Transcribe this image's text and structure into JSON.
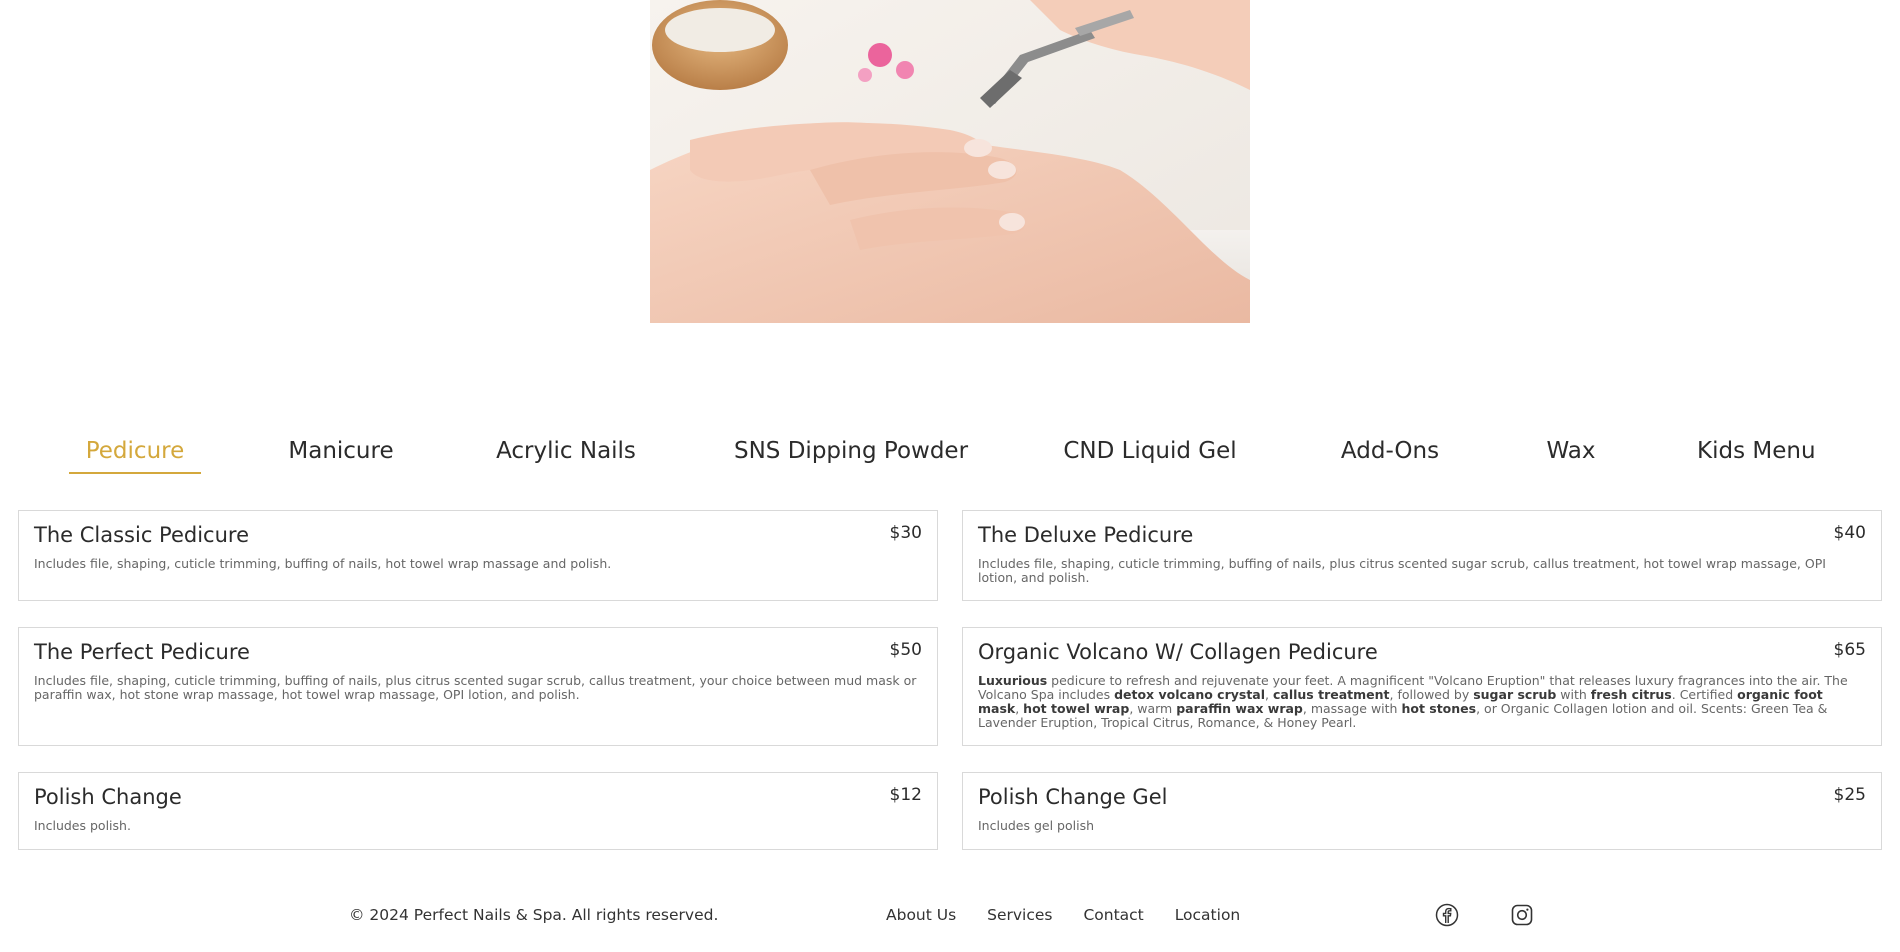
{
  "tabs": [
    {
      "label": "Pedicure",
      "active": true
    },
    {
      "label": "Manicure",
      "active": false
    },
    {
      "label": "Acrylic Nails",
      "active": false
    },
    {
      "label": "SNS Dipping Powder",
      "active": false
    },
    {
      "label": "CND Liquid Gel",
      "active": false
    },
    {
      "label": "Add-Ons",
      "active": false
    },
    {
      "label": "Wax",
      "active": false
    },
    {
      "label": "Kids Menu",
      "active": false
    }
  ],
  "services": [
    {
      "title": "The Classic Pedicure",
      "price": "$30",
      "desc": "Includes file, shaping, cuticle trimming, buffing of nails, hot towel wrap massage and polish."
    },
    {
      "title": "The Deluxe Pedicure",
      "price": "$40",
      "desc": "Includes file, shaping, cuticle trimming, buffing of nails, plus citrus scented sugar scrub, callus treatment, hot towel wrap massage, OPI lotion, and polish."
    },
    {
      "title": "The Perfect Pedicure",
      "price": "$50",
      "desc": "Includes file, shaping, cuticle trimming, buffing of nails, plus citrus scented sugar scrub, callus treatment, your choice between mud mask or paraffin wax, hot stone wrap massage, hot towel wrap massage, OPI lotion, and polish."
    },
    {
      "title": "Organic Volcano W/ Collagen Pedicure",
      "price": "$65",
      "desc_parts": [
        {
          "text": "Luxurious",
          "bold": true
        },
        {
          "text": " pedicure to refresh and rejuvenate your feet. A magnificent \"Volcano Eruption\" that releases luxury fragrances into the air. The Volcano Spa includes ",
          "bold": false
        },
        {
          "text": "detox volcano crystal",
          "bold": true
        },
        {
          "text": ", ",
          "bold": false
        },
        {
          "text": "callus treatment",
          "bold": true
        },
        {
          "text": ", followed by ",
          "bold": false
        },
        {
          "text": "sugar scrub",
          "bold": true
        },
        {
          "text": " with ",
          "bold": false
        },
        {
          "text": "fresh citrus",
          "bold": true
        },
        {
          "text": ". Certified ",
          "bold": false
        },
        {
          "text": "organic foot mask",
          "bold": true
        },
        {
          "text": ", ",
          "bold": false
        },
        {
          "text": "hot towel wrap",
          "bold": true
        },
        {
          "text": ", warm ",
          "bold": false
        },
        {
          "text": "paraffin wax wrap",
          "bold": true
        },
        {
          "text": ", massage with ",
          "bold": false
        },
        {
          "text": "hot stones",
          "bold": true
        },
        {
          "text": ", or Organic Collagen lotion and oil. Scents: Green Tea & Lavender Eruption, Tropical Citrus, Romance, & Honey Pearl.",
          "bold": false
        }
      ]
    },
    {
      "title": "Polish Change",
      "price": "$12",
      "desc": "Includes polish."
    },
    {
      "title": "Polish Change Gel",
      "price": "$25",
      "desc": "Includes gel polish"
    }
  ],
  "footer": {
    "copyright": "© 2024 Perfect Nails & Spa. All rights reserved.",
    "links": [
      "About Us",
      "Services",
      "Contact",
      "Location"
    ]
  },
  "social": [
    "facebook-icon",
    "instagram-icon"
  ],
  "colors": {
    "accent": "#d4a83c",
    "text": "#2b2b2b",
    "border": "#d9d9d9"
  }
}
